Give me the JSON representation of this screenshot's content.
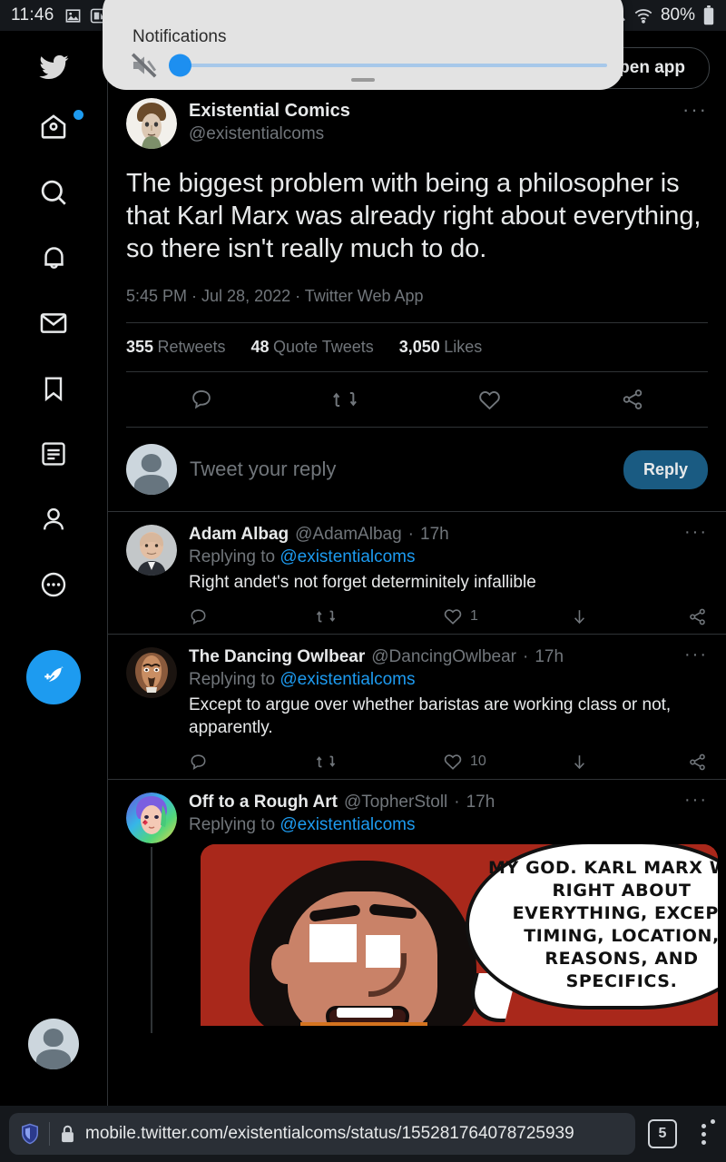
{
  "status_bar": {
    "clock": "11:46",
    "battery": "80%",
    "icons": [
      "image-icon",
      "app-icon",
      "screenshot-icon",
      "mute-icon",
      "wifi-icon",
      "battery-icon"
    ]
  },
  "volume_overlay": {
    "title": "Notifications",
    "icon": "mute-speaker-icon",
    "slider_value": 2
  },
  "sidebar": {
    "logo": "twitter-bird-icon",
    "items": [
      {
        "name": "home",
        "icon": "home-icon",
        "badge": true
      },
      {
        "name": "explore",
        "icon": "search-icon",
        "badge": false
      },
      {
        "name": "notifications",
        "icon": "bell-icon",
        "badge": false
      },
      {
        "name": "messages",
        "icon": "envelope-icon",
        "badge": false
      },
      {
        "name": "bookmarks",
        "icon": "bookmark-icon",
        "badge": false
      },
      {
        "name": "lists",
        "icon": "lists-icon",
        "badge": false
      },
      {
        "name": "profile",
        "icon": "person-icon",
        "badge": false
      },
      {
        "name": "more",
        "icon": "more-circle-icon",
        "badge": false
      }
    ],
    "compose_icon": "compose-tweet-icon",
    "avatar": "default-avatar"
  },
  "open_app_button": {
    "label": "Open app"
  },
  "main_tweet": {
    "author_name": "Existential Comics",
    "author_handle": "@existentialcoms",
    "avatar": "existential-comics-avatar",
    "text": "The biggest problem with being a philosopher is that Karl Marx was already right about everything, so there isn't really much to do.",
    "meta": "5:45 PM · Jul 28, 2022 · Twitter Web App",
    "stats": [
      {
        "count": "355",
        "label": "Retweets"
      },
      {
        "count": "48",
        "label": "Quote Tweets"
      },
      {
        "count": "3,050",
        "label": "Likes"
      }
    ],
    "actions": [
      "reply-icon",
      "retweet-icon",
      "like-icon",
      "share-icon"
    ],
    "more_dots": "···"
  },
  "reply_composer": {
    "placeholder": "Tweet your reply",
    "button_label": "Reply",
    "avatar": "default-avatar"
  },
  "replies": [
    {
      "name": "Adam Albag",
      "handle": "@AdamAlbag",
      "time": "17h",
      "replying_prefix": "Replying to ",
      "replying_to": "@existentialcoms",
      "text": "Right andet's not forget determinitely infallible",
      "like_count": "1",
      "reply_count": "",
      "retweet_count": "",
      "more_dots": "···"
    },
    {
      "name": "The Dancing Owlbear",
      "handle": "@DancingOwlbear",
      "time": "17h",
      "replying_prefix": "Replying to ",
      "replying_to": "@existentialcoms",
      "text": "Except to argue over whether baristas are working class or not, apparently.",
      "like_count": "10",
      "reply_count": "",
      "retweet_count": "",
      "more_dots": "···"
    },
    {
      "name": "Off to a Rough Art",
      "handle": "@TopherStoll",
      "time": "17h",
      "replying_prefix": "Replying to ",
      "replying_to": "@existentialcoms",
      "text": "",
      "like_count": "",
      "reply_count": "",
      "retweet_count": "",
      "more_dots": "···"
    }
  ],
  "comic": {
    "alt": "comic-panel-karl-marx",
    "speech_bubble": "MY GOD.  KARL MARX WAS RIGHT ABOUT EVERYTHING, EXCEPT TIMING, LOCATION, REASONS, AND SPECIFICS.",
    "background_color": "#a9281b"
  },
  "browser_bar": {
    "shield_icon": "brave-shield-icon",
    "lock_icon": "lock-icon",
    "url": "mobile.twitter.com/existentialcoms/status/155281764078725939",
    "tab_count": "5",
    "menu_icon": "kebab-menu-icon"
  },
  "colors": {
    "accent": "#1d9bf0",
    "background": "#000000",
    "border": "#2f3336",
    "muted_text": "#71767b",
    "primary_text": "#e7e9ea"
  }
}
